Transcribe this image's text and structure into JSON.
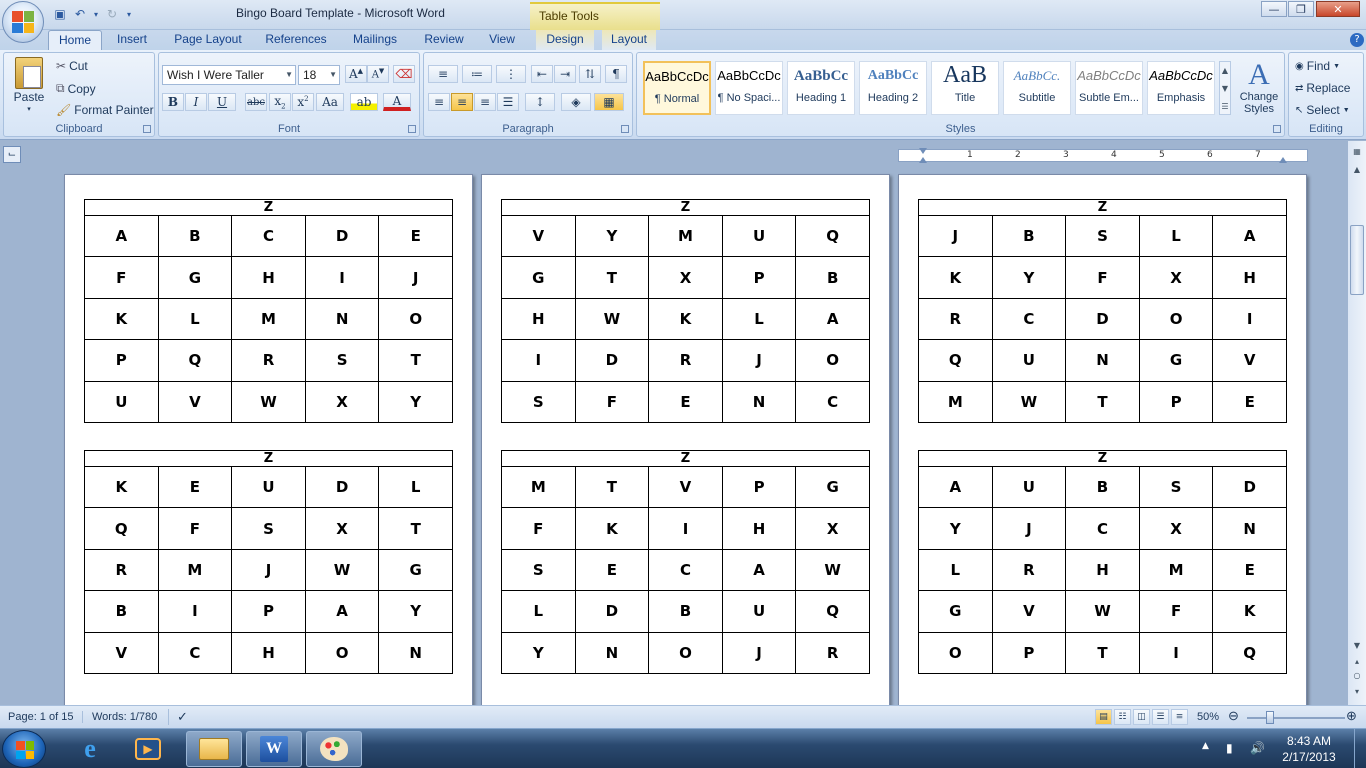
{
  "titlebar": {
    "title": "Bingo Board Template - Microsoft Word",
    "context_tab": "Table Tools"
  },
  "tabs": [
    "Home",
    "Insert",
    "Page Layout",
    "References",
    "Mailings",
    "Review",
    "View",
    "Design",
    "Layout"
  ],
  "clipboard": {
    "paste": "Paste",
    "cut": "Cut",
    "copy": "Copy",
    "format_painter": "Format Painter",
    "label": "Clipboard"
  },
  "font": {
    "name": "Wish I Were Taller",
    "size": "18",
    "label": "Font"
  },
  "paragraph": {
    "label": "Paragraph"
  },
  "styles": {
    "label": "Styles",
    "items": [
      {
        "preview": "AaBbCcDc",
        "name": "¶ Normal"
      },
      {
        "preview": "AaBbCcDc",
        "name": "¶ No Spaci..."
      },
      {
        "preview": "AaBbCc",
        "name": "Heading 1"
      },
      {
        "preview": "AaBbCc",
        "name": "Heading 2"
      },
      {
        "preview": "AaB",
        "name": "Title"
      },
      {
        "preview": "AaBbCc.",
        "name": "Subtitle"
      },
      {
        "preview": "AaBbCcDc",
        "name": "Subtle Em..."
      },
      {
        "preview": "AaBbCcDc",
        "name": "Emphasis"
      }
    ],
    "change_styles": "Change Styles"
  },
  "editing": {
    "find": "Find",
    "replace": "Replace",
    "select": "Select",
    "label": "Editing"
  },
  "ruler_numbers": [
    "1",
    "2",
    "3",
    "4",
    "5",
    "6",
    "7"
  ],
  "boards": [
    {
      "header": "Z",
      "rows": [
        [
          "A",
          "B",
          "C",
          "D",
          "E"
        ],
        [
          "F",
          "G",
          "H",
          "I",
          "J"
        ],
        [
          "K",
          "L",
          "M",
          "N",
          "O"
        ],
        [
          "P",
          "Q",
          "R",
          "S",
          "T"
        ],
        [
          "U",
          "V",
          "W",
          "X",
          "Y"
        ]
      ]
    },
    {
      "header": "Z",
      "rows": [
        [
          "K",
          "E",
          "U",
          "D",
          "L"
        ],
        [
          "Q",
          "F",
          "S",
          "X",
          "T"
        ],
        [
          "R",
          "M",
          "J",
          "W",
          "G"
        ],
        [
          "B",
          "I",
          "P",
          "A",
          "Y"
        ],
        [
          "V",
          "C",
          "H",
          "O",
          "N"
        ]
      ]
    },
    {
      "header": "Z",
      "rows": [
        [
          "V",
          "Y",
          "M",
          "U",
          "Q"
        ],
        [
          "G",
          "T",
          "X",
          "P",
          "B"
        ],
        [
          "H",
          "W",
          "K",
          "L",
          "A"
        ],
        [
          "I",
          "D",
          "R",
          "J",
          "O"
        ],
        [
          "S",
          "F",
          "E",
          "N",
          "C"
        ]
      ]
    },
    {
      "header": "Z",
      "rows": [
        [
          "M",
          "T",
          "V",
          "P",
          "G"
        ],
        [
          "F",
          "K",
          "I",
          "H",
          "X"
        ],
        [
          "S",
          "E",
          "C",
          "A",
          "W"
        ],
        [
          "L",
          "D",
          "B",
          "U",
          "Q"
        ],
        [
          "Y",
          "N",
          "O",
          "J",
          "R"
        ]
      ]
    },
    {
      "header": "Z",
      "rows": [
        [
          "J",
          "B",
          "S",
          "L",
          "A"
        ],
        [
          "K",
          "Y",
          "F",
          "X",
          "H"
        ],
        [
          "R",
          "C",
          "D",
          "O",
          "I"
        ],
        [
          "Q",
          "U",
          "N",
          "G",
          "V"
        ],
        [
          "M",
          "W",
          "T",
          "P",
          "E"
        ]
      ]
    },
    {
      "header": "Z",
      "rows": [
        [
          "A",
          "U",
          "B",
          "S",
          "D"
        ],
        [
          "Y",
          "J",
          "C",
          "X",
          "N"
        ],
        [
          "L",
          "R",
          "H",
          "M",
          "E"
        ],
        [
          "G",
          "V",
          "W",
          "F",
          "K"
        ],
        [
          "O",
          "P",
          "T",
          "I",
          "Q"
        ]
      ]
    }
  ],
  "status": {
    "page": "Page: 1 of 15",
    "words": "Words: 1/780",
    "zoom": "50%"
  },
  "clock": {
    "time": "8:43 AM",
    "date": "2/17/2013"
  }
}
